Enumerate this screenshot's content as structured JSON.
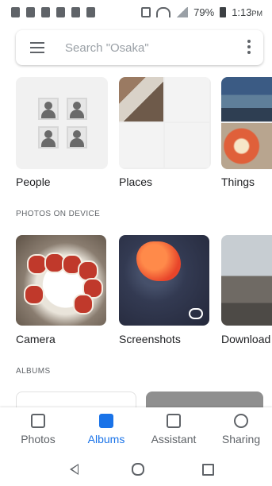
{
  "status_bar": {
    "battery": "79%",
    "time": "1:13",
    "ampm": "PM"
  },
  "search": {
    "placeholder": "Search \"Osaka\""
  },
  "categories": [
    {
      "label": "People"
    },
    {
      "label": "Places"
    },
    {
      "label": "Things"
    }
  ],
  "sections": {
    "photos_on_device": "PHOTOS ON DEVICE",
    "albums": "ALBUMS"
  },
  "device_folders": [
    {
      "label": "Camera"
    },
    {
      "label": "Screenshots"
    },
    {
      "label": "Download"
    }
  ],
  "bottom_nav": [
    {
      "label": "Photos",
      "icon": "photos-icon"
    },
    {
      "label": "Albums",
      "icon": "albums-icon",
      "active": true
    },
    {
      "label": "Assistant",
      "icon": "assistant-icon"
    },
    {
      "label": "Sharing",
      "icon": "sharing-icon"
    }
  ],
  "colors": {
    "accent": "#1a73e8"
  }
}
